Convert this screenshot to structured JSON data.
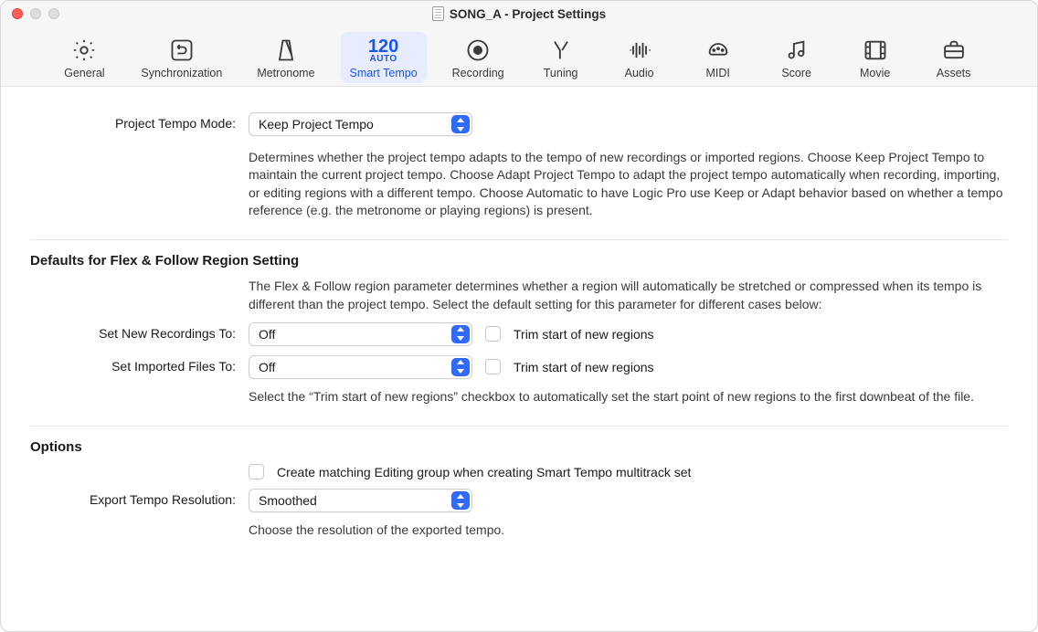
{
  "window": {
    "title": "SONG_A - Project Settings"
  },
  "toolbar": {
    "general": "General",
    "sync": "Synchronization",
    "metronome": "Metronome",
    "smarttempo": "Smart Tempo",
    "smarttempo_bpm": "120",
    "smarttempo_auto": "AUTO",
    "recording": "Recording",
    "tuning": "Tuning",
    "audio": "Audio",
    "midi": "MIDI",
    "score": "Score",
    "movie": "Movie",
    "assets": "Assets"
  },
  "tempo": {
    "label": "Project Tempo Mode:",
    "value": "Keep Project Tempo",
    "desc": "Determines whether the project tempo adapts to the tempo of new recordings or imported regions. Choose Keep Project Tempo to maintain the current project tempo. Choose Adapt Project Tempo to adapt the project tempo automatically when recording, importing, or editing regions with a different tempo. Choose Automatic to  have Logic Pro use Keep or Adapt behavior based on whether a tempo reference (e.g. the metronome or playing regions) is present."
  },
  "flex": {
    "heading": "Defaults for Flex & Follow Region Setting",
    "intro": "The Flex & Follow region parameter determines whether a region will automatically be stretched or compressed when its tempo is different than the project tempo. Select the default setting for this parameter for different cases below:",
    "new_label": "Set New Recordings To:",
    "new_value": "Off",
    "import_label": "Set Imported Files To:",
    "import_value": "Off",
    "trim_label": "Trim start of new regions",
    "trim_desc": "Select the “Trim start of new regions” checkbox to automatically set the start point of new regions to the first downbeat of the file."
  },
  "options": {
    "heading": "Options",
    "create_group_label": "Create matching Editing group when creating Smart Tempo multitrack set",
    "export_label": "Export Tempo Resolution:",
    "export_value": "Smoothed",
    "export_desc": "Choose the resolution of the exported tempo."
  }
}
